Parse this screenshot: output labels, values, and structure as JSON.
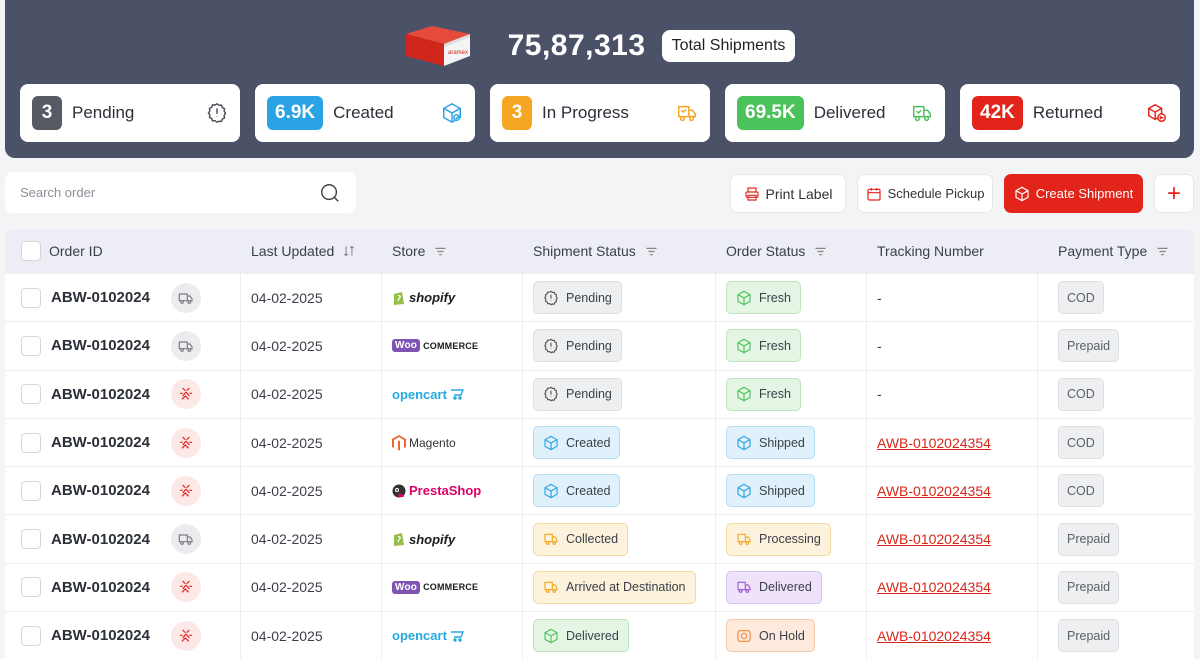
{
  "header": {
    "total_value": "75,87,313",
    "total_label": "Total Shipments",
    "brand_on_box": "aramex",
    "stats": [
      {
        "value": "3",
        "label": "Pending",
        "color": "#555a63",
        "icon": "alert-circle-icon"
      },
      {
        "value": "6.9K",
        "label": "Created",
        "color": "#2aa3e6",
        "icon": "box-icon"
      },
      {
        "value": "3",
        "label": "In Progress",
        "color": "#f5a623",
        "icon": "truck-fast-icon"
      },
      {
        "value": "69.5K",
        "label": "Delivered",
        "color": "#4cc25a",
        "icon": "truck-check-icon"
      },
      {
        "value": "42K",
        "label": "Returned",
        "color": "#e3241b",
        "icon": "return-box-icon"
      }
    ]
  },
  "toolbar": {
    "search_placeholder": "Search order",
    "print_label": "Print Label",
    "schedule_label": "Schedule Pickup",
    "create_label": "Create Shipment",
    "plus_label": "+"
  },
  "table": {
    "columns": [
      "Order ID",
      "Last Updated",
      "Store",
      "Shipment Status",
      "Order Status",
      "Tracking Number",
      "Payment Type"
    ],
    "rows": [
      {
        "order": "ABW-0102024",
        "type": "truck",
        "date": "04-02-2025",
        "store": "shopify",
        "ship": "Pending",
        "ship_color": "gray",
        "ord": "Fresh",
        "ord_color": "green",
        "track": "-",
        "pay": "COD"
      },
      {
        "order": "ABW-0102024",
        "type": "truck",
        "date": "04-02-2025",
        "store": "woo",
        "ship": "Pending",
        "ship_color": "gray",
        "ord": "Fresh",
        "ord_color": "green",
        "track": "-",
        "pay": "Prepaid"
      },
      {
        "order": "ABW-0102024",
        "type": "cancel",
        "date": "04-02-2025",
        "store": "opencart",
        "ship": "Pending",
        "ship_color": "gray",
        "ord": "Fresh",
        "ord_color": "green",
        "track": "-",
        "pay": "COD"
      },
      {
        "order": "ABW-0102024",
        "type": "cancel",
        "date": "04-02-2025",
        "store": "magento",
        "ship": "Created",
        "ship_color": "blue",
        "ord": "Shipped",
        "ord_color": "blue",
        "track": "AWB-0102024354",
        "pay": "COD"
      },
      {
        "order": "ABW-0102024",
        "type": "cancel",
        "date": "04-02-2025",
        "store": "presta",
        "ship": "Created",
        "ship_color": "blue",
        "ord": "Shipped",
        "ord_color": "blue",
        "track": "AWB-0102024354",
        "pay": "COD"
      },
      {
        "order": "ABW-0102024",
        "type": "truck",
        "date": "04-02-2025",
        "store": "shopify",
        "ship": "Collected",
        "ship_color": "orange",
        "ord": "Processing",
        "ord_color": "orange",
        "track": "AWB-0102024354",
        "pay": "Prepaid"
      },
      {
        "order": "ABW-0102024",
        "type": "cancel",
        "date": "04-02-2025",
        "store": "woo",
        "ship": "Arrived at Destination",
        "ship_color": "orange",
        "ord": "Delivered",
        "ord_color": "purple",
        "track": "AWB-0102024354",
        "pay": "Prepaid"
      },
      {
        "order": "ABW-0102024",
        "type": "cancel",
        "date": "04-02-2025",
        "store": "opencart",
        "ship": "Delivered",
        "ship_color": "green",
        "ord": "On Hold",
        "ord_color": "peach",
        "track": "AWB-0102024354",
        "pay": "Prepaid"
      }
    ]
  },
  "store_labels": {
    "shopify": "shopify",
    "woo_mark": "Woo",
    "woo_text": "COMMERCE",
    "opencart": "opencart",
    "magento": "Magento",
    "presta": "PrestaShop"
  }
}
